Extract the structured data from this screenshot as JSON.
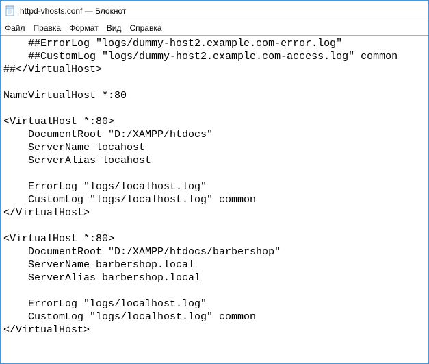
{
  "titlebar": {
    "title": "httpd-vhosts.conf — Блокнот"
  },
  "menu": {
    "file": "Файл",
    "edit": "Правка",
    "format": "Формат",
    "view": "Вид",
    "help": "Справка"
  },
  "content": "    ##ErrorLog \"logs/dummy-host2.example.com-error.log\"\n    ##CustomLog \"logs/dummy-host2.example.com-access.log\" common\n##</VirtualHost>\n\nNameVirtualHost *:80\n\n<VirtualHost *:80>\n    DocumentRoot \"D:/XAMPP/htdocs\"\n    ServerName locahost\n    ServerAlias locahost\n\n    ErrorLog \"logs/localhost.log\"\n    CustomLog \"logs/localhost.log\" common\n</VirtualHost>\n\n<VirtualHost *:80>\n    DocumentRoot \"D:/XAMPP/htdocs/barbershop\"\n    ServerName barbershop.local\n    ServerAlias barbershop.local\n\n    ErrorLog \"logs/localhost.log\"\n    CustomLog \"logs/localhost.log\" common\n</VirtualHost>"
}
